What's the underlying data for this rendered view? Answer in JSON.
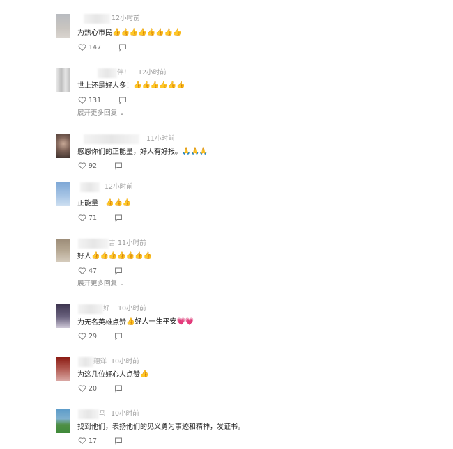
{
  "comments": [
    {
      "name_tail": "",
      "time": "12小时前",
      "text": "为热心市民",
      "emoji": "👍👍👍👍👍👍👍👍",
      "emoji_type": "thumb",
      "likes": "147",
      "expand": "",
      "avatar_colors": [
        "#b8bbc0",
        "#d9d4cf"
      ]
    },
    {
      "name_tail": "伴！",
      "time": "12小时前",
      "text": "世上还是好人多！",
      "emoji": "👍👍👍👍👍👍",
      "emoji_type": "thumb",
      "likes": "131",
      "expand": "展开更多回复",
      "avatar_colors": [
        "#e2e2e2",
        "#b9b9b9"
      ]
    },
    {
      "name_tail": "",
      "time": "11小时前",
      "text": "感恩你们的正能量，好人有好报。",
      "emoji": "🙏🙏🙏",
      "emoji_type": "pray",
      "likes": "92",
      "expand": "",
      "avatar_colors": [
        "#5a4740",
        "#c7b4a6"
      ]
    },
    {
      "name_tail": "",
      "time": "12小时前",
      "text": "正能量！",
      "emoji": "👍👍👍",
      "emoji_type": "thumb",
      "likes": "71",
      "expand": "",
      "avatar_colors": [
        "#7fa8d6",
        "#cfe0f1"
      ]
    },
    {
      "name_tail": "吉",
      "time": "11小时前",
      "text": "好人",
      "emoji": "👍👍👍👍👍👍👍",
      "emoji_type": "thumb",
      "likes": "47",
      "expand": "展开更多回复",
      "avatar_colors": [
        "#9c8c78",
        "#d7cdbf"
      ]
    },
    {
      "name_tail": "好",
      "time": "10小时前",
      "text": "为无名英雄点赞",
      "emoji": "👍好人一生平安💗💗",
      "emoji_type": "mixed",
      "likes": "29",
      "expand": "",
      "avatar_colors": [
        "#3d3550",
        "#cdc7d6"
      ]
    },
    {
      "name_tail": "翔洋",
      "time": "10小时前",
      "text": "为这几位好心人点赞",
      "emoji": "👍",
      "emoji_type": "thumb",
      "likes": "20",
      "expand": "",
      "avatar_colors": [
        "#8c1c14",
        "#d9a7a3"
      ]
    },
    {
      "name_tail": "马",
      "time": "10小时前",
      "text": "找到他们，表扬他们的见义勇为事迹和精神，发证书。",
      "emoji": "",
      "emoji_type": "none",
      "likes": "17",
      "expand": "",
      "avatar_colors": [
        "#5d9cc9",
        "#3f8a3a"
      ]
    }
  ],
  "icons": {
    "like": "heart-outline-icon",
    "reply": "comment-bubble-icon",
    "expand": "chevron-down-icon"
  }
}
